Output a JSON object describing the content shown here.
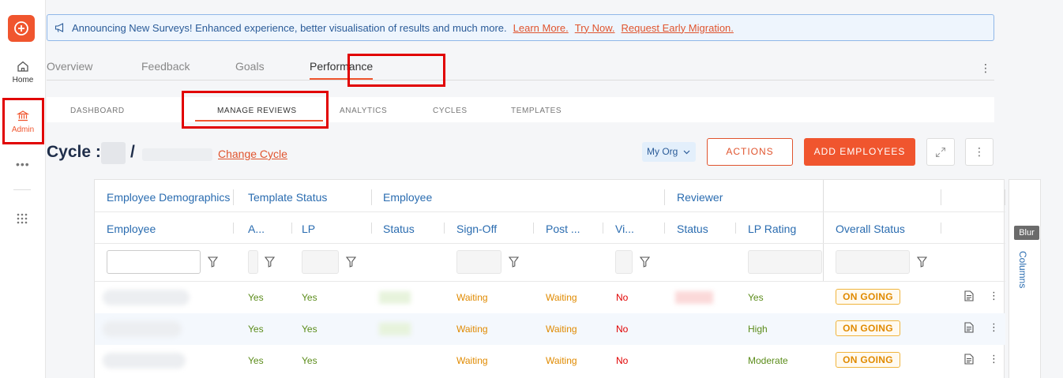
{
  "sidebar": {
    "items": [
      {
        "label": "Home"
      },
      {
        "label": "Admin"
      }
    ]
  },
  "banner": {
    "text": "Announcing New Surveys! Enhanced experience, better visualisation of results and much more.",
    "links": [
      "Learn More.",
      "Try Now.",
      "Request Early Migration."
    ]
  },
  "tabs": [
    "Overview",
    "Feedback",
    "Goals",
    "Performance"
  ],
  "subtabs": [
    "DASHBOARD",
    "MANAGE REVIEWS",
    "ANALYTICS",
    "CYCLES",
    "TEMPLATES"
  ],
  "cycle": {
    "title": "Cycle :",
    "slash": "/",
    "change_label": "Change Cycle"
  },
  "toolbar": {
    "org_label": "My Org",
    "actions_label": "ACTIONS",
    "add_label": "ADD EMPLOYEES"
  },
  "table": {
    "groups": [
      "Employee Demographics",
      "Template Status",
      "Employee",
      "Reviewer"
    ],
    "headers": [
      "Employee",
      "A...",
      "LP",
      "Status",
      "Sign-Off",
      "Post ...",
      "Vi...",
      "Status",
      "LP Rating",
      "Overall Status"
    ],
    "rows": [
      {
        "a": "Yes",
        "lp": "Yes",
        "signoff": "Waiting",
        "post": "Waiting",
        "vi": "No",
        "lp_rating": "Yes",
        "overall": "ON GOING"
      },
      {
        "a": "Yes",
        "lp": "Yes",
        "signoff": "Waiting",
        "post": "Waiting",
        "vi": "No",
        "lp_rating": "High",
        "overall": "ON GOING"
      },
      {
        "a": "Yes",
        "lp": "Yes",
        "signoff": "Waiting",
        "post": "Waiting",
        "vi": "No",
        "lp_rating": "Moderate",
        "overall": "ON GOING"
      }
    ]
  },
  "columns_panel": {
    "label": "Columns",
    "tooltip": "Blur"
  },
  "colors": {
    "brand": "#f0552e",
    "link_blue": "#2a6cb0",
    "highlight_red": "#e10000"
  }
}
